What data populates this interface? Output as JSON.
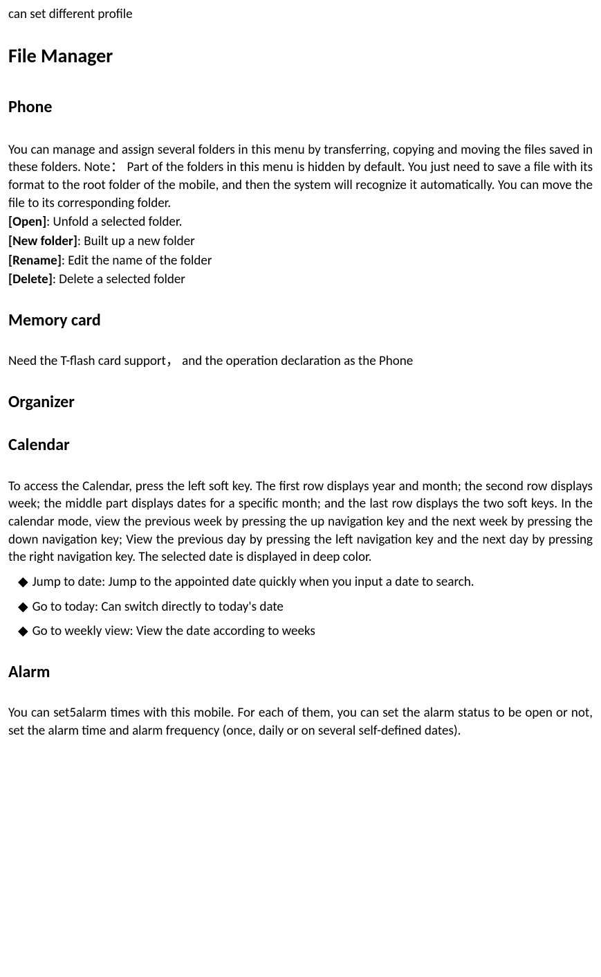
{
  "intro": "can set different profile",
  "file_manager": {
    "title": "File Manager",
    "phone": {
      "title": "Phone",
      "paragraph": "You can manage and assign several folders in this menu by transferring, copying and moving the files saved in these folders. Note： Part of the folders in this menu is hidden by default. You just need to save a file with its format to the root folder of the mobile, and then the system will recognize it automatically. You can move the file to its corresponding folder.",
      "defs": [
        {
          "label": "[Open]",
          "text": ": Unfold a selected folder."
        },
        {
          "label": "[New folder]",
          "text": ": Built up a new folder"
        },
        {
          "label": "[Rename]",
          "text": ": Edit the name of the folder"
        },
        {
          "label": "[Delete]",
          "text": ": Delete a selected folder"
        }
      ]
    },
    "memory_card": {
      "title": "Memory card",
      "paragraph": "Need the T-flash card support，   and the operation declaration as the Phone"
    }
  },
  "organizer": {
    "title": "Organizer",
    "calendar": {
      "title": "Calendar",
      "paragraph": "To access the Calendar, press the left soft key. The first row displays year and month; the second row displays week; the middle part displays dates for a specific month; and the last row displays the two soft keys. In the calendar mode, view the previous week by pressing the up navigation key and the next week by pressing the down navigation key; View the previous day by pressing the left navigation key and the next day by pressing the right navigation key. The selected date is displayed in deep color.",
      "bullets": [
        "Jump to date: Jump to the appointed date quickly when you input a date to search.",
        "Go to today: Can switch directly to today's date",
        "Go to weekly view: View the date according to weeks"
      ]
    },
    "alarm": {
      "title": "Alarm",
      "paragraph": "You can set5alarm times with this mobile. For each of them, you can set the alarm status to be open or not, set the alarm time and alarm frequency (once, daily or on several self-defined dates)."
    }
  },
  "diamond": "◆"
}
